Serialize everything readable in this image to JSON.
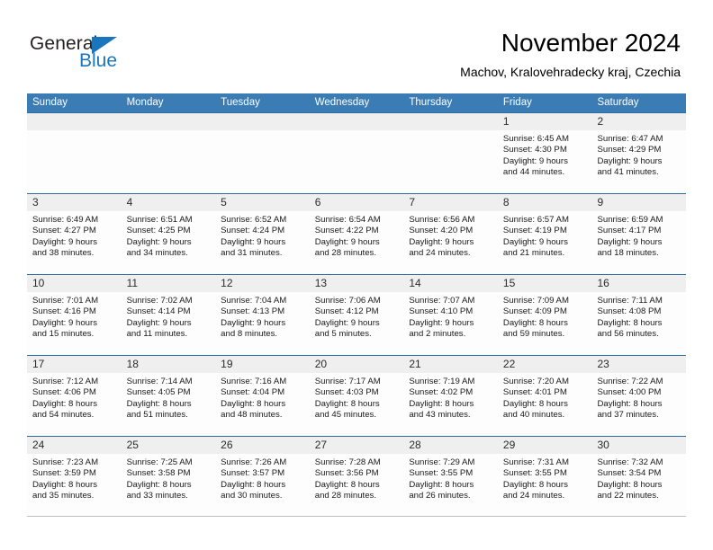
{
  "brand": {
    "name_part1": "General",
    "name_part2": "Blue",
    "triangle_color": "#1b75bc",
    "text_color": "#231f20"
  },
  "header": {
    "title": "November 2024",
    "subtitle": "Machov, Kralovehradecky kraj, Czechia"
  },
  "theme": {
    "header_blue": "#3b7cb5",
    "row_border_blue": "#2a6ca5",
    "daynum_band": "#efefef"
  },
  "weekdays": [
    "Sunday",
    "Monday",
    "Tuesday",
    "Wednesday",
    "Thursday",
    "Friday",
    "Saturday"
  ],
  "weeks": [
    [
      {
        "day": "",
        "sunrise": "",
        "sunset": "",
        "daylight_line1": "",
        "daylight_line2": ""
      },
      {
        "day": "",
        "sunrise": "",
        "sunset": "",
        "daylight_line1": "",
        "daylight_line2": ""
      },
      {
        "day": "",
        "sunrise": "",
        "sunset": "",
        "daylight_line1": "",
        "daylight_line2": ""
      },
      {
        "day": "",
        "sunrise": "",
        "sunset": "",
        "daylight_line1": "",
        "daylight_line2": ""
      },
      {
        "day": "",
        "sunrise": "",
        "sunset": "",
        "daylight_line1": "",
        "daylight_line2": ""
      },
      {
        "day": "1",
        "sunrise": "Sunrise: 6:45 AM",
        "sunset": "Sunset: 4:30 PM",
        "daylight_line1": "Daylight: 9 hours",
        "daylight_line2": "and 44 minutes."
      },
      {
        "day": "2",
        "sunrise": "Sunrise: 6:47 AM",
        "sunset": "Sunset: 4:29 PM",
        "daylight_line1": "Daylight: 9 hours",
        "daylight_line2": "and 41 minutes."
      }
    ],
    [
      {
        "day": "3",
        "sunrise": "Sunrise: 6:49 AM",
        "sunset": "Sunset: 4:27 PM",
        "daylight_line1": "Daylight: 9 hours",
        "daylight_line2": "and 38 minutes."
      },
      {
        "day": "4",
        "sunrise": "Sunrise: 6:51 AM",
        "sunset": "Sunset: 4:25 PM",
        "daylight_line1": "Daylight: 9 hours",
        "daylight_line2": "and 34 minutes."
      },
      {
        "day": "5",
        "sunrise": "Sunrise: 6:52 AM",
        "sunset": "Sunset: 4:24 PM",
        "daylight_line1": "Daylight: 9 hours",
        "daylight_line2": "and 31 minutes."
      },
      {
        "day": "6",
        "sunrise": "Sunrise: 6:54 AM",
        "sunset": "Sunset: 4:22 PM",
        "daylight_line1": "Daylight: 9 hours",
        "daylight_line2": "and 28 minutes."
      },
      {
        "day": "7",
        "sunrise": "Sunrise: 6:56 AM",
        "sunset": "Sunset: 4:20 PM",
        "daylight_line1": "Daylight: 9 hours",
        "daylight_line2": "and 24 minutes."
      },
      {
        "day": "8",
        "sunrise": "Sunrise: 6:57 AM",
        "sunset": "Sunset: 4:19 PM",
        "daylight_line1": "Daylight: 9 hours",
        "daylight_line2": "and 21 minutes."
      },
      {
        "day": "9",
        "sunrise": "Sunrise: 6:59 AM",
        "sunset": "Sunset: 4:17 PM",
        "daylight_line1": "Daylight: 9 hours",
        "daylight_line2": "and 18 minutes."
      }
    ],
    [
      {
        "day": "10",
        "sunrise": "Sunrise: 7:01 AM",
        "sunset": "Sunset: 4:16 PM",
        "daylight_line1": "Daylight: 9 hours",
        "daylight_line2": "and 15 minutes."
      },
      {
        "day": "11",
        "sunrise": "Sunrise: 7:02 AM",
        "sunset": "Sunset: 4:14 PM",
        "daylight_line1": "Daylight: 9 hours",
        "daylight_line2": "and 11 minutes."
      },
      {
        "day": "12",
        "sunrise": "Sunrise: 7:04 AM",
        "sunset": "Sunset: 4:13 PM",
        "daylight_line1": "Daylight: 9 hours",
        "daylight_line2": "and 8 minutes."
      },
      {
        "day": "13",
        "sunrise": "Sunrise: 7:06 AM",
        "sunset": "Sunset: 4:12 PM",
        "daylight_line1": "Daylight: 9 hours",
        "daylight_line2": "and 5 minutes."
      },
      {
        "day": "14",
        "sunrise": "Sunrise: 7:07 AM",
        "sunset": "Sunset: 4:10 PM",
        "daylight_line1": "Daylight: 9 hours",
        "daylight_line2": "and 2 minutes."
      },
      {
        "day": "15",
        "sunrise": "Sunrise: 7:09 AM",
        "sunset": "Sunset: 4:09 PM",
        "daylight_line1": "Daylight: 8 hours",
        "daylight_line2": "and 59 minutes."
      },
      {
        "day": "16",
        "sunrise": "Sunrise: 7:11 AM",
        "sunset": "Sunset: 4:08 PM",
        "daylight_line1": "Daylight: 8 hours",
        "daylight_line2": "and 56 minutes."
      }
    ],
    [
      {
        "day": "17",
        "sunrise": "Sunrise: 7:12 AM",
        "sunset": "Sunset: 4:06 PM",
        "daylight_line1": "Daylight: 8 hours",
        "daylight_line2": "and 54 minutes."
      },
      {
        "day": "18",
        "sunrise": "Sunrise: 7:14 AM",
        "sunset": "Sunset: 4:05 PM",
        "daylight_line1": "Daylight: 8 hours",
        "daylight_line2": "and 51 minutes."
      },
      {
        "day": "19",
        "sunrise": "Sunrise: 7:16 AM",
        "sunset": "Sunset: 4:04 PM",
        "daylight_line1": "Daylight: 8 hours",
        "daylight_line2": "and 48 minutes."
      },
      {
        "day": "20",
        "sunrise": "Sunrise: 7:17 AM",
        "sunset": "Sunset: 4:03 PM",
        "daylight_line1": "Daylight: 8 hours",
        "daylight_line2": "and 45 minutes."
      },
      {
        "day": "21",
        "sunrise": "Sunrise: 7:19 AM",
        "sunset": "Sunset: 4:02 PM",
        "daylight_line1": "Daylight: 8 hours",
        "daylight_line2": "and 43 minutes."
      },
      {
        "day": "22",
        "sunrise": "Sunrise: 7:20 AM",
        "sunset": "Sunset: 4:01 PM",
        "daylight_line1": "Daylight: 8 hours",
        "daylight_line2": "and 40 minutes."
      },
      {
        "day": "23",
        "sunrise": "Sunrise: 7:22 AM",
        "sunset": "Sunset: 4:00 PM",
        "daylight_line1": "Daylight: 8 hours",
        "daylight_line2": "and 37 minutes."
      }
    ],
    [
      {
        "day": "24",
        "sunrise": "Sunrise: 7:23 AM",
        "sunset": "Sunset: 3:59 PM",
        "daylight_line1": "Daylight: 8 hours",
        "daylight_line2": "and 35 minutes."
      },
      {
        "day": "25",
        "sunrise": "Sunrise: 7:25 AM",
        "sunset": "Sunset: 3:58 PM",
        "daylight_line1": "Daylight: 8 hours",
        "daylight_line2": "and 33 minutes."
      },
      {
        "day": "26",
        "sunrise": "Sunrise: 7:26 AM",
        "sunset": "Sunset: 3:57 PM",
        "daylight_line1": "Daylight: 8 hours",
        "daylight_line2": "and 30 minutes."
      },
      {
        "day": "27",
        "sunrise": "Sunrise: 7:28 AM",
        "sunset": "Sunset: 3:56 PM",
        "daylight_line1": "Daylight: 8 hours",
        "daylight_line2": "and 28 minutes."
      },
      {
        "day": "28",
        "sunrise": "Sunrise: 7:29 AM",
        "sunset": "Sunset: 3:55 PM",
        "daylight_line1": "Daylight: 8 hours",
        "daylight_line2": "and 26 minutes."
      },
      {
        "day": "29",
        "sunrise": "Sunrise: 7:31 AM",
        "sunset": "Sunset: 3:55 PM",
        "daylight_line1": "Daylight: 8 hours",
        "daylight_line2": "and 24 minutes."
      },
      {
        "day": "30",
        "sunrise": "Sunrise: 7:32 AM",
        "sunset": "Sunset: 3:54 PM",
        "daylight_line1": "Daylight: 8 hours",
        "daylight_line2": "and 22 minutes."
      }
    ]
  ]
}
